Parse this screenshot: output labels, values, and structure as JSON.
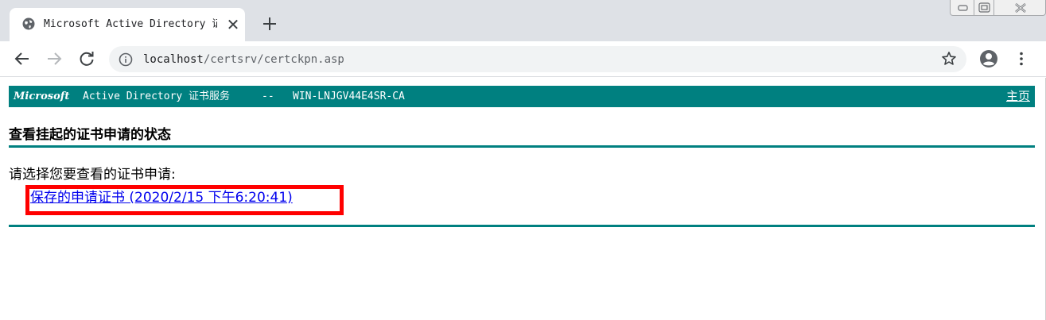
{
  "browser": {
    "tab_title": "Microsoft Active Directory 证书服务",
    "tab_close": "✕",
    "url_host": "localhost",
    "url_path": "/certsrv/certckpn.asp"
  },
  "header": {
    "brand": "Microsoft",
    "product": "Active Directory 证书服务",
    "separator": "--",
    "ca_name": "WIN-LNJGV44E4SR-CA",
    "home_link": "主页"
  },
  "page": {
    "title": "查看挂起的证书申请的状态",
    "prompt": "请选择您要查看的证书申请:",
    "request_link": "保存的申请证书 (2020/2/15 下午6:20:41)"
  },
  "colors": {
    "brand_teal": "#008080",
    "link_blue": "#0000ee",
    "highlight_red": "#ff0000"
  }
}
